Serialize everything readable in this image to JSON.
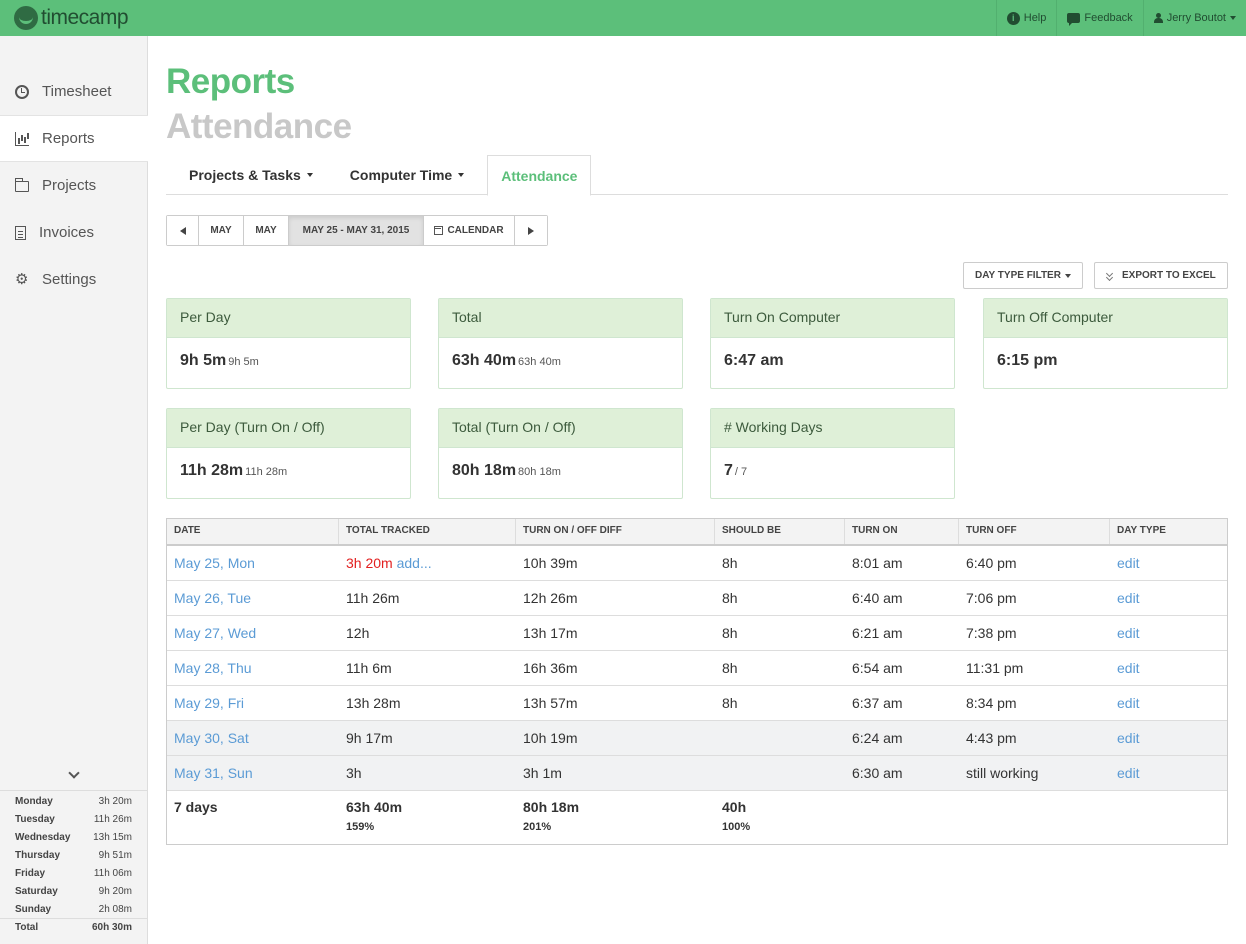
{
  "app": {
    "name": "timecamp"
  },
  "topbar": {
    "help": "Help",
    "feedback": "Feedback",
    "user": "Jerry Boutot"
  },
  "sidebar": {
    "items": [
      {
        "label": "Timesheet"
      },
      {
        "label": "Reports"
      },
      {
        "label": "Projects"
      },
      {
        "label": "Invoices"
      },
      {
        "label": "Settings"
      }
    ],
    "week": [
      {
        "day": "Monday",
        "value": "3h 20m"
      },
      {
        "day": "Tuesday",
        "value": "11h 26m"
      },
      {
        "day": "Wednesday",
        "value": "13h 15m"
      },
      {
        "day": "Thursday",
        "value": "9h 51m"
      },
      {
        "day": "Friday",
        "value": "11h 06m"
      },
      {
        "day": "Saturday",
        "value": "9h 20m"
      },
      {
        "day": "Sunday",
        "value": "2h 08m"
      }
    ],
    "week_total": {
      "label": "Total",
      "value": "60h 30m"
    }
  },
  "page": {
    "title": "Reports",
    "subtitle": "Attendance"
  },
  "tabs": [
    {
      "label": "Projects & Tasks"
    },
    {
      "label": "Computer Time"
    },
    {
      "label": "Attendance"
    }
  ],
  "date_nav": {
    "prev_month": "MAY",
    "cur_month": "MAY",
    "range": "MAY 25 - MAY 31, 2015",
    "calendar": "CALENDAR"
  },
  "actions": {
    "day_type_filter": "DAY TYPE FILTER",
    "export": "EXPORT TO EXCEL"
  },
  "cards": [
    {
      "title": "Per Day",
      "value": "9h 5m",
      "sub": "9h 5m"
    },
    {
      "title": "Total",
      "value": "63h 40m",
      "sub": "63h 40m"
    },
    {
      "title": "Turn On Computer",
      "value": "6:47 am",
      "sub": ""
    },
    {
      "title": "Turn Off Computer",
      "value": "6:15 pm",
      "sub": ""
    },
    {
      "title": "Per Day (Turn On / Off)",
      "value": "11h 28m",
      "sub": "11h 28m"
    },
    {
      "title": "Total (Turn On / Off)",
      "value": "80h 18m",
      "sub": "80h 18m"
    },
    {
      "title": "# Working Days",
      "value": "7",
      "sub": "/ 7"
    }
  ],
  "table": {
    "headers": [
      "DATE",
      "TOTAL TRACKED",
      "TURN ON / OFF DIFF",
      "SHOULD BE",
      "TURN ON",
      "TURN OFF",
      "DAY TYPE"
    ],
    "rows": [
      {
        "date": "May 25, Mon",
        "tracked": "3h 20m",
        "add": "add...",
        "diff": "10h 39m",
        "should": "8h",
        "on": "8:01 am",
        "off": "6:40 pm",
        "type": "edit"
      },
      {
        "date": "May 26, Tue",
        "tracked": "11h 26m",
        "add": "",
        "diff": "12h 26m",
        "should": "8h",
        "on": "6:40 am",
        "off": "7:06 pm",
        "type": "edit"
      },
      {
        "date": "May 27, Wed",
        "tracked": "12h",
        "add": "",
        "diff": "13h 17m",
        "should": "8h",
        "on": "6:21 am",
        "off": "7:38 pm",
        "type": "edit"
      },
      {
        "date": "May 28, Thu",
        "tracked": "11h 6m",
        "add": "",
        "diff": "16h 36m",
        "should": "8h",
        "on": "6:54 am",
        "off": "11:31 pm",
        "type": "edit"
      },
      {
        "date": "May 29, Fri",
        "tracked": "13h 28m",
        "add": "",
        "diff": "13h 57m",
        "should": "8h",
        "on": "6:37 am",
        "off": "8:34 pm",
        "type": "edit"
      },
      {
        "date": "May 30, Sat",
        "tracked": "9h 17m",
        "add": "",
        "diff": "10h 19m",
        "should": "",
        "on": "6:24 am",
        "off": "4:43 pm",
        "type": "edit"
      },
      {
        "date": "May 31, Sun",
        "tracked": "3h",
        "add": "",
        "diff": "3h 1m",
        "should": "",
        "on": "6:30 am",
        "off": "still working",
        "type": "edit"
      }
    ],
    "footer": {
      "days": "7 days",
      "tracked": "63h 40m",
      "tracked_pct": "159%",
      "diff": "80h 18m",
      "diff_pct": "201%",
      "should": "40h",
      "should_pct": "100%"
    }
  }
}
